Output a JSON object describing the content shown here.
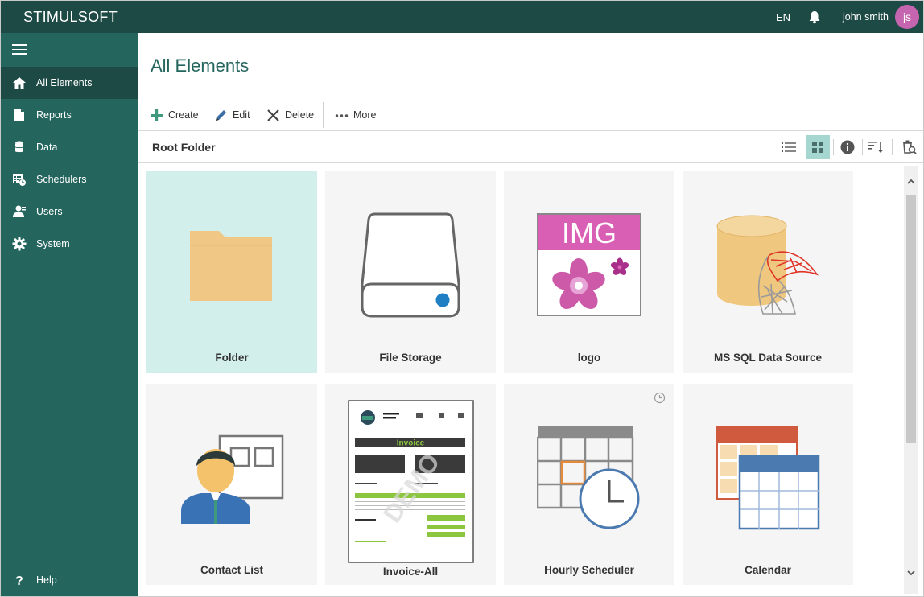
{
  "header": {
    "brand": "STIMULSOFT",
    "language": "EN",
    "user_name": "john smith",
    "user_initials": "js"
  },
  "sidebar": {
    "items": [
      {
        "label": "All Elements",
        "icon": "home-icon",
        "active": true
      },
      {
        "label": "Reports",
        "icon": "report-file-icon"
      },
      {
        "label": "Data",
        "icon": "database-icon"
      },
      {
        "label": "Schedulers",
        "icon": "scheduler-icon"
      },
      {
        "label": "Users",
        "icon": "users-icon"
      },
      {
        "label": "System",
        "icon": "gear-icon"
      }
    ],
    "help_label": "Help"
  },
  "main": {
    "title": "All Elements",
    "toolbar": {
      "create": "Create",
      "edit": "Edit",
      "delete": "Delete",
      "more": "More"
    },
    "folder_title": "Root Folder",
    "view_mode": "tiles",
    "items": [
      {
        "label": "Folder",
        "icon": "folder-icon",
        "selected": true
      },
      {
        "label": "File Storage",
        "icon": "file-storage-icon"
      },
      {
        "label": "logo",
        "icon": "image-icon",
        "badge_text": "IMG"
      },
      {
        "label": "MS SQL Data Source",
        "icon": "ms-sql-icon"
      },
      {
        "label": "Contact List",
        "icon": "contact-list-icon"
      },
      {
        "label": "Invoice-All",
        "icon": "invoice-thumbnail",
        "thumbnail_heading": "Invoice",
        "watermark": "DEMO"
      },
      {
        "label": "Hourly Scheduler",
        "icon": "hourly-scheduler-icon"
      },
      {
        "label": "Calendar",
        "icon": "calendar-icon"
      }
    ]
  },
  "colors": {
    "topbar": "#1e4a45",
    "sidebar": "#24655d",
    "accent": "#24655d",
    "selected_tile": "#d3efeb",
    "avatar": "#c565b0"
  }
}
